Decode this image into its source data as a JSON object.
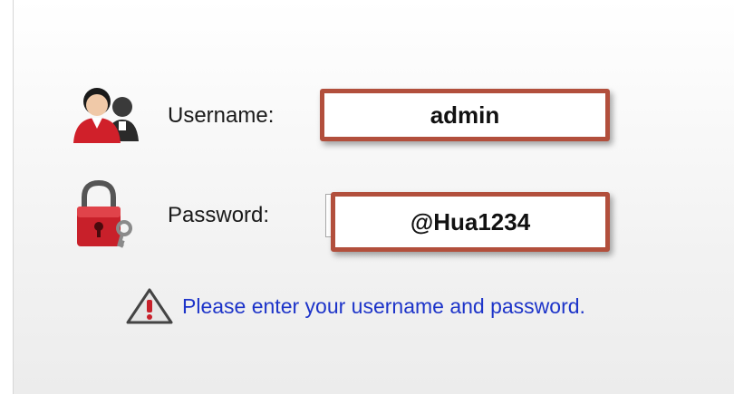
{
  "login": {
    "username_label": "Username:",
    "username_value": "admin",
    "password_label": "Password:",
    "password_value": "@Hua1234",
    "message": "Please enter your username and password."
  },
  "icons": {
    "user": "users-icon",
    "lock": "lock-icon",
    "warning": "warning-icon"
  },
  "colors": {
    "field_border": "#b24f3c",
    "message_text": "#1d34c9",
    "icon_red": "#d0202a"
  }
}
